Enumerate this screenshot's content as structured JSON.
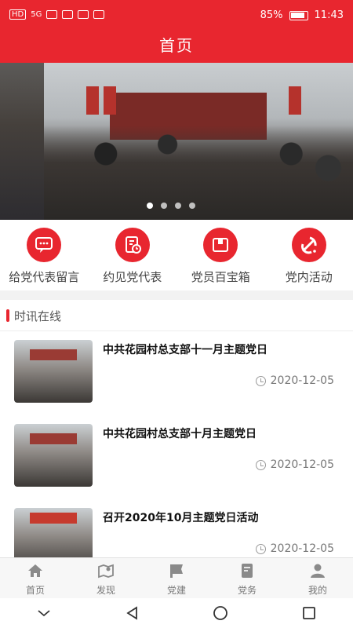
{
  "status_bar": {
    "left_indicators": "HD",
    "network": "5G",
    "battery_percent": "85%",
    "time": "11:43"
  },
  "header": {
    "title": "首页"
  },
  "banner": {
    "slide_count": 4,
    "active_slide": 1
  },
  "quick_actions": [
    {
      "label": "给党代表留言",
      "icon": "message-icon"
    },
    {
      "label": "约见党代表",
      "icon": "appointment-icon"
    },
    {
      "label": "党员百宝箱",
      "icon": "toolbox-icon"
    },
    {
      "label": "党内活动",
      "icon": "party-emblem-icon"
    }
  ],
  "news_section": {
    "title": "时讯在线",
    "items": [
      {
        "title": "中共花园村总支部十一月主题党日",
        "date": "2020-12-05"
      },
      {
        "title": "中共花园村总支部十月主题党日",
        "date": "2020-12-05"
      },
      {
        "title": "召开2020年10月主题党日活动",
        "date": "2020-12-05"
      }
    ]
  },
  "tabs": [
    {
      "label": "首页",
      "icon": "home-icon"
    },
    {
      "label": "发现",
      "icon": "map-icon"
    },
    {
      "label": "党建",
      "icon": "flag-icon"
    },
    {
      "label": "党务",
      "icon": "document-icon"
    },
    {
      "label": "我的",
      "icon": "user-icon"
    }
  ],
  "colors": {
    "accent": "#e8262f",
    "tab_icon": "#8a8a8a"
  }
}
